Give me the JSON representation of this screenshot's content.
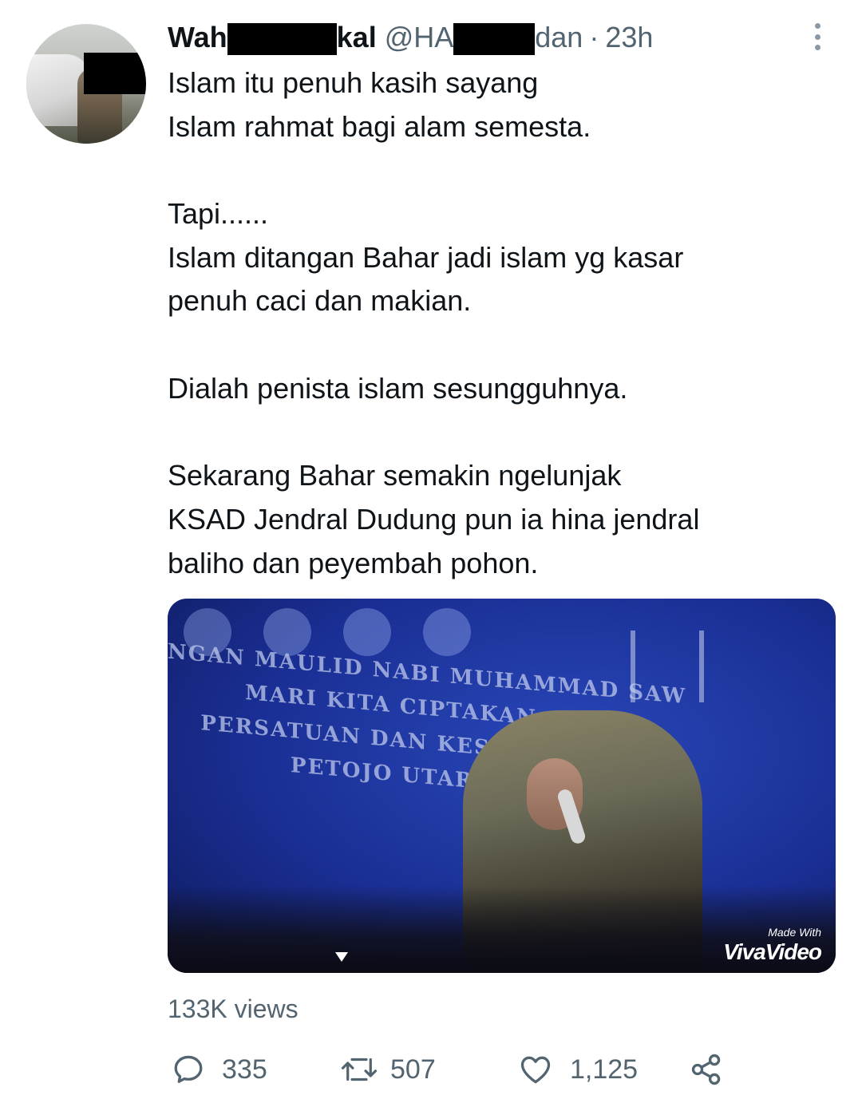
{
  "tweet": {
    "author": {
      "name_start": "Wah",
      "name_end": "kal",
      "handle_start": "@HA",
      "handle_end": "dan",
      "separator": "·",
      "time": "23h"
    },
    "text_lines": [
      "Islam itu penuh kasih sayang",
      "Islam rahmat bagi alam semesta.",
      "",
      "Tapi......",
      "Islam ditangan Bahar jadi islam yg kasar",
      "penuh caci dan makian.",
      "",
      "Dialah penista islam sesungguhnya.",
      "",
      "Sekarang Bahar semakin ngelunjak",
      "KSAD Jendral Dudung pun ia hina jendral",
      "baliho dan peyembah pohon."
    ],
    "media": {
      "banner_lines": [
        "NGAN MAULID NABI MUHAMMAD SAW",
        "MARI KITA CIPTAKAN",
        "PERSATUAN DAN KESATUAN",
        "PETOJO UTARA"
      ],
      "watermark_small": "Made With",
      "watermark_big": "VivaVideo"
    },
    "views": "133K views",
    "actions": {
      "replies": "335",
      "retweets": "507",
      "likes": "1,125"
    }
  },
  "icons": {
    "more": "more-vertical-icon",
    "reply": "reply-icon",
    "retweet": "retweet-icon",
    "like": "heart-icon",
    "share": "share-icon"
  },
  "colors": {
    "text_primary": "#0f1419",
    "text_secondary": "#536471",
    "redaction": "#000000"
  }
}
